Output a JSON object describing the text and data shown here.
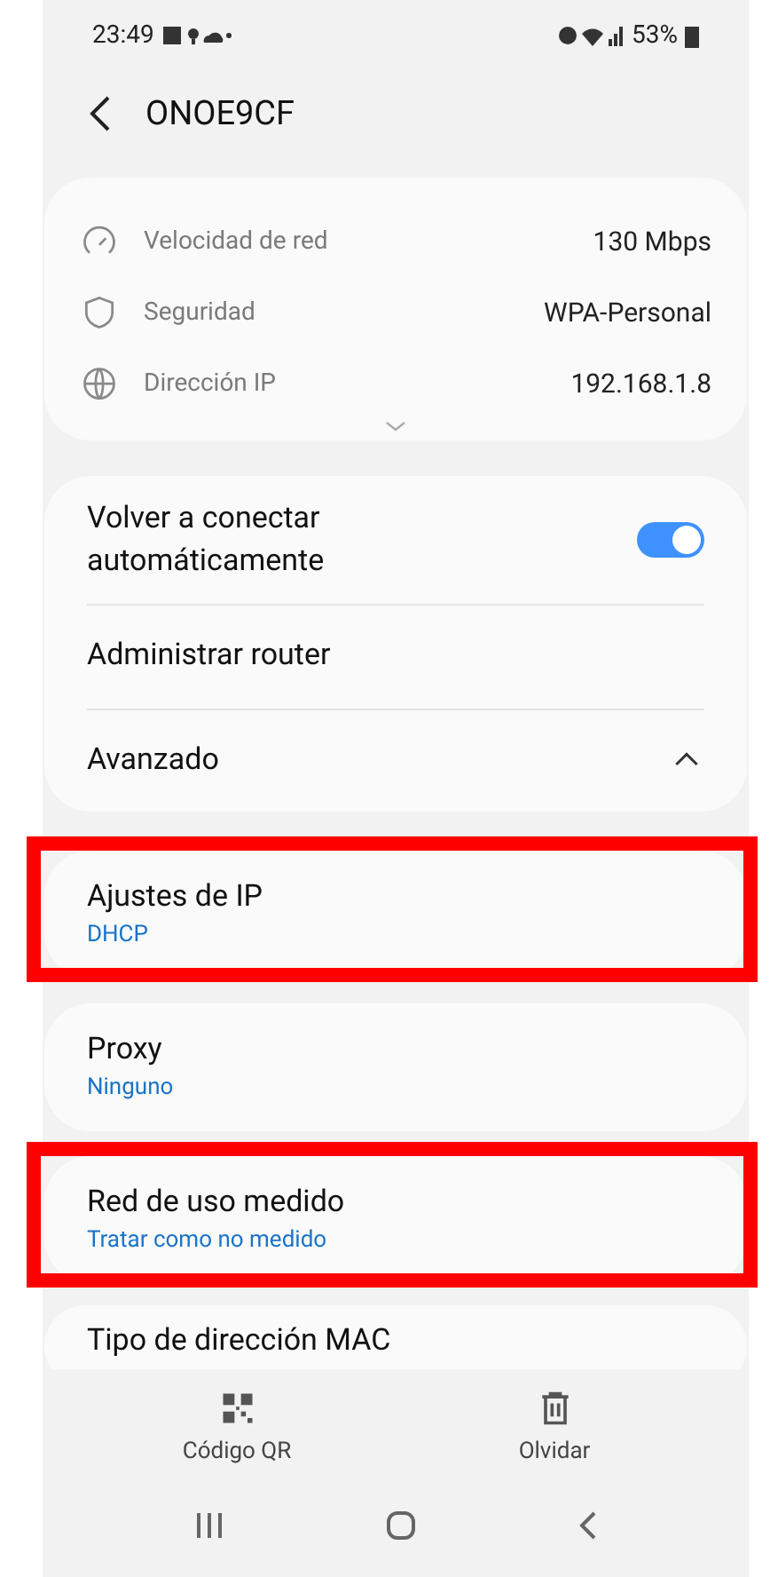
{
  "status_bar": {
    "time": "23:49",
    "battery": "53%"
  },
  "header": {
    "title": "ONOE9CF"
  },
  "info": [
    {
      "kind": "speed",
      "label": "Velocidad de red",
      "value": "130 Mbps"
    },
    {
      "kind": "shield",
      "label": "Seguridad",
      "value": "WPA-Personal"
    },
    {
      "kind": "globe",
      "label": "Dirección IP",
      "value": "192.168.1.8"
    }
  ],
  "settings": [
    {
      "kind": "toggle",
      "label": "Volver a conectar automáticamente",
      "on": true
    },
    {
      "kind": "link",
      "label": "Administrar router"
    },
    {
      "kind": "expander",
      "label": "Avanzado",
      "expanded": true
    }
  ],
  "options": [
    {
      "title": "Ajustes de IP",
      "subtitle": "DHCP",
      "highlighted": true
    },
    {
      "title": "Proxy",
      "subtitle": "Ninguno",
      "highlighted": false
    },
    {
      "title": "Red de uso medido",
      "subtitle": "Tratar como no medido",
      "highlighted": true
    },
    {
      "title": "Tipo de dirección MAC",
      "highlighted": false
    }
  ],
  "actions": [
    {
      "kind": "qr",
      "label": "Código QR"
    },
    {
      "kind": "trash",
      "label": "Olvidar"
    }
  ]
}
